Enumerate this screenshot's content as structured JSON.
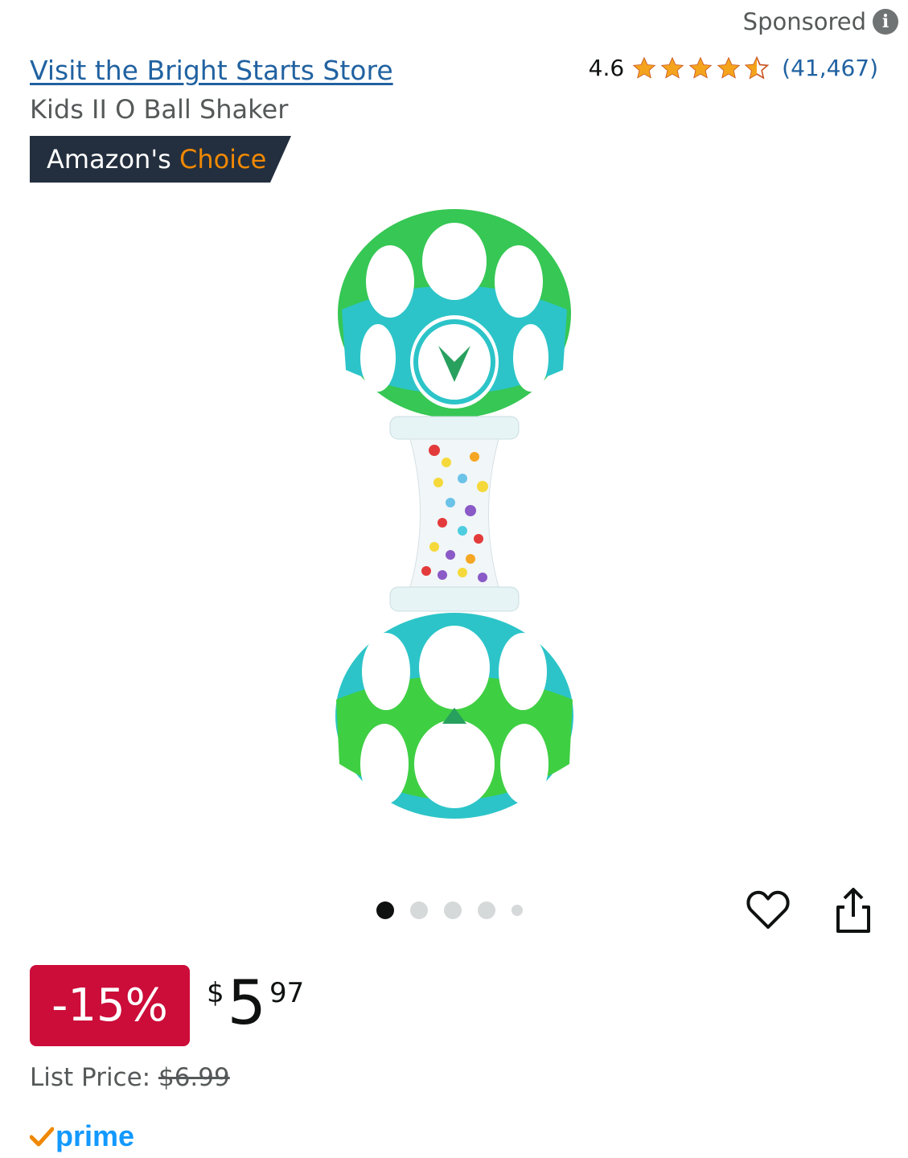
{
  "header": {
    "sponsored_label": "Sponsored",
    "store_link": "Visit the Bright Starts Store",
    "product_title": "Kids II O Ball Shaker"
  },
  "rating": {
    "value": "4.6",
    "stars": 4.5,
    "count": "(41,467)"
  },
  "badge": {
    "prefix": "Amazon's",
    "highlight": "Choice"
  },
  "carousel": {
    "total": 5,
    "active_index": 0
  },
  "price": {
    "discount": "-15%",
    "symbol": "$",
    "whole": "5",
    "fraction": "97",
    "list_label": "List Price:",
    "list_value": "$6.99"
  },
  "prime": {
    "label": "prime"
  },
  "colors": {
    "link": "#2162A1",
    "star": "#F4A41C",
    "discount_bg": "#CC0C39",
    "badge_bg": "#232F3E",
    "badge_highlight": "#F08804",
    "prime": "#1399FF"
  },
  "icons": [
    "info-icon",
    "star-icon",
    "heart-icon",
    "share-icon",
    "prime-check-icon"
  ]
}
